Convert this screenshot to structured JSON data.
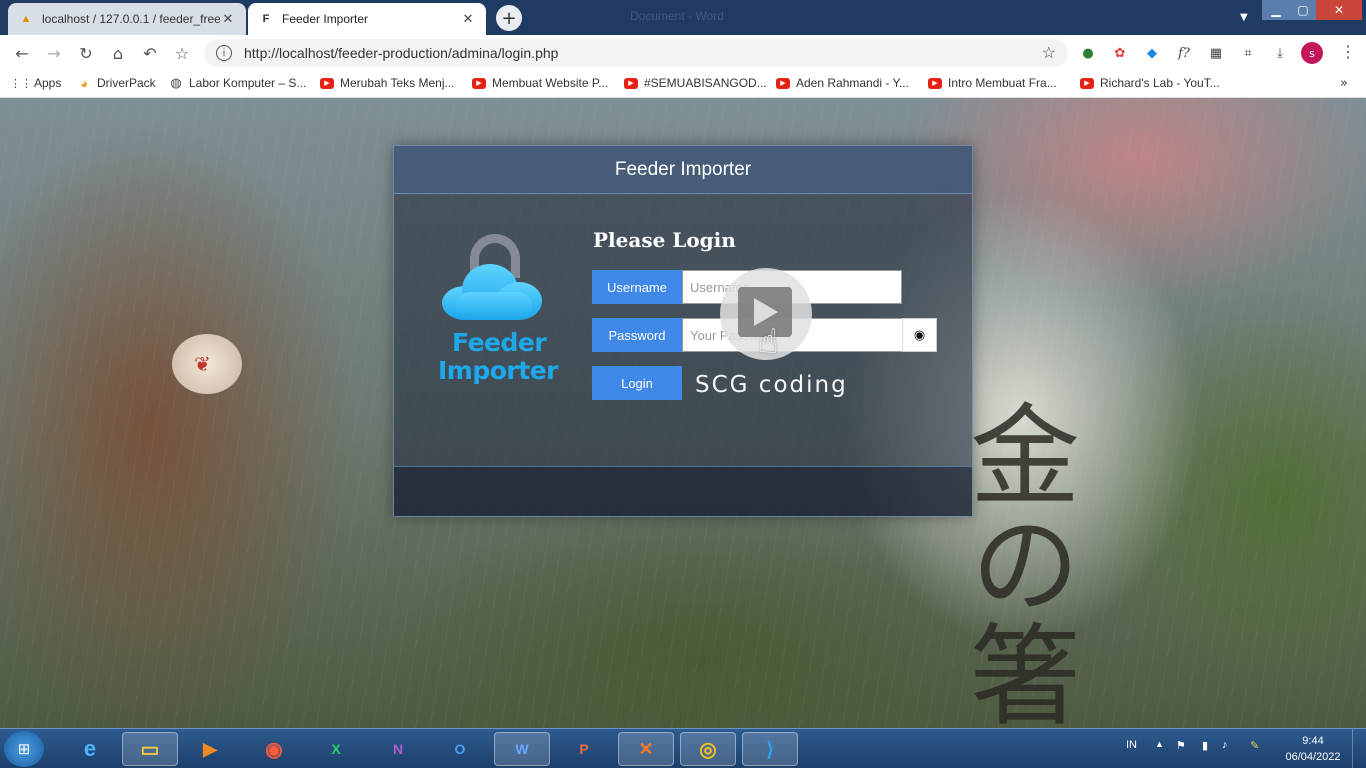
{
  "browser": {
    "tabs": [
      {
        "title": "localhost / 127.0.0.1 / feeder_free",
        "icon": "phpmyadmin-icon"
      },
      {
        "title": "Feeder Importer",
        "icon": "feeder-favicon-icon"
      }
    ],
    "background_window_title": "Document - Word",
    "url": "http://localhost/feeder-production/admina/login.php",
    "profile_initial": "s",
    "bookmarks": [
      {
        "label": "Apps",
        "icon": "apps-grid-icon"
      },
      {
        "label": "DriverPack",
        "icon": "driverpack-icon"
      },
      {
        "label": "Labor Komputer – S...",
        "icon": "globe-icon"
      },
      {
        "label": "Merubah Teks Menj...",
        "icon": "youtube-icon"
      },
      {
        "label": "Membuat Website P...",
        "icon": "youtube-icon"
      },
      {
        "label": "#SEMUABISANGOD...",
        "icon": "youtube-icon"
      },
      {
        "label": "Aden Rahmandi - Y...",
        "icon": "youtube-icon"
      },
      {
        "label": "Intro Membuat Fra...",
        "icon": "youtube-icon"
      },
      {
        "label": "Richard's Lab - YouT...",
        "icon": "youtube-icon"
      }
    ]
  },
  "page": {
    "panel_title": "Feeder Importer",
    "logo_line1": "Feeder",
    "logo_line2": "Importer",
    "heading": "Please Login",
    "username_label": "Username",
    "username_placeholder": "Username",
    "password_label": "Password",
    "password_placeholder": "Your Password",
    "login_button": "Login",
    "watermark": "SCG coding",
    "bg_kanji": "金の箸"
  },
  "taskbar": {
    "apps": [
      "Internet Explorer",
      "File Explorer",
      "Media Player",
      "Screen Recorder",
      "Excel",
      "OneNote",
      "Outlook",
      "Word",
      "PowerPoint",
      "XAMPP",
      "Chrome",
      "VS Code"
    ],
    "language": "IN",
    "time": "9:44",
    "date": "06/04/2022"
  },
  "colors": {
    "accent": "#3f88e8",
    "tabstrip": "#1f3a63",
    "logo": "#1ea8ec"
  }
}
